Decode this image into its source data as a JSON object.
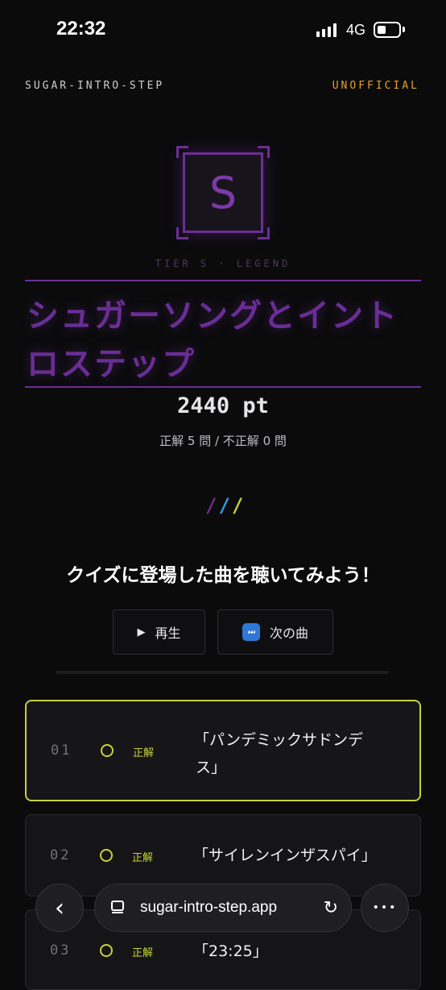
{
  "status_bar": {
    "time": "22:32",
    "network": "4G"
  },
  "header": {
    "brand": "SUGAR-INTRO-STEP",
    "badge": "UNOFFICIAL"
  },
  "emblem": {
    "letter": "S",
    "tier_label": "TIER S · LEGEND"
  },
  "result": {
    "song_title_line1": "シュガーソングとイント",
    "song_title_line2": "ロステップ",
    "score": "2440 pt",
    "stats": "正解 5 問 / 不正解 0 問"
  },
  "prompt": "クイズに登場した曲を聴いてみよう！",
  "buttons": {
    "play_icon": "▶",
    "play_label": "再生",
    "next_icon": "⏭",
    "next_label": "次の曲"
  },
  "tracks": [
    {
      "num": "01",
      "result": "正解",
      "title_line1": "「パンデミックサドンデ",
      "title_line2": "ス」"
    },
    {
      "num": "02",
      "result": "正解",
      "title_line1": "「サイレンインザスパイ」"
    },
    {
      "num": "03",
      "result": "正解",
      "title_line1": "「23:25」"
    }
  ],
  "browser": {
    "url": "sugar-intro-step.app",
    "back_icon": "‹",
    "more_icon": "•••",
    "reload_icon": "↻"
  },
  "colors": {
    "accent_purple": "#6a2f93",
    "accent_yellow": "#c6d23a",
    "accent_blue": "#2f9fe0",
    "badge_orange": "#e0a22b"
  }
}
